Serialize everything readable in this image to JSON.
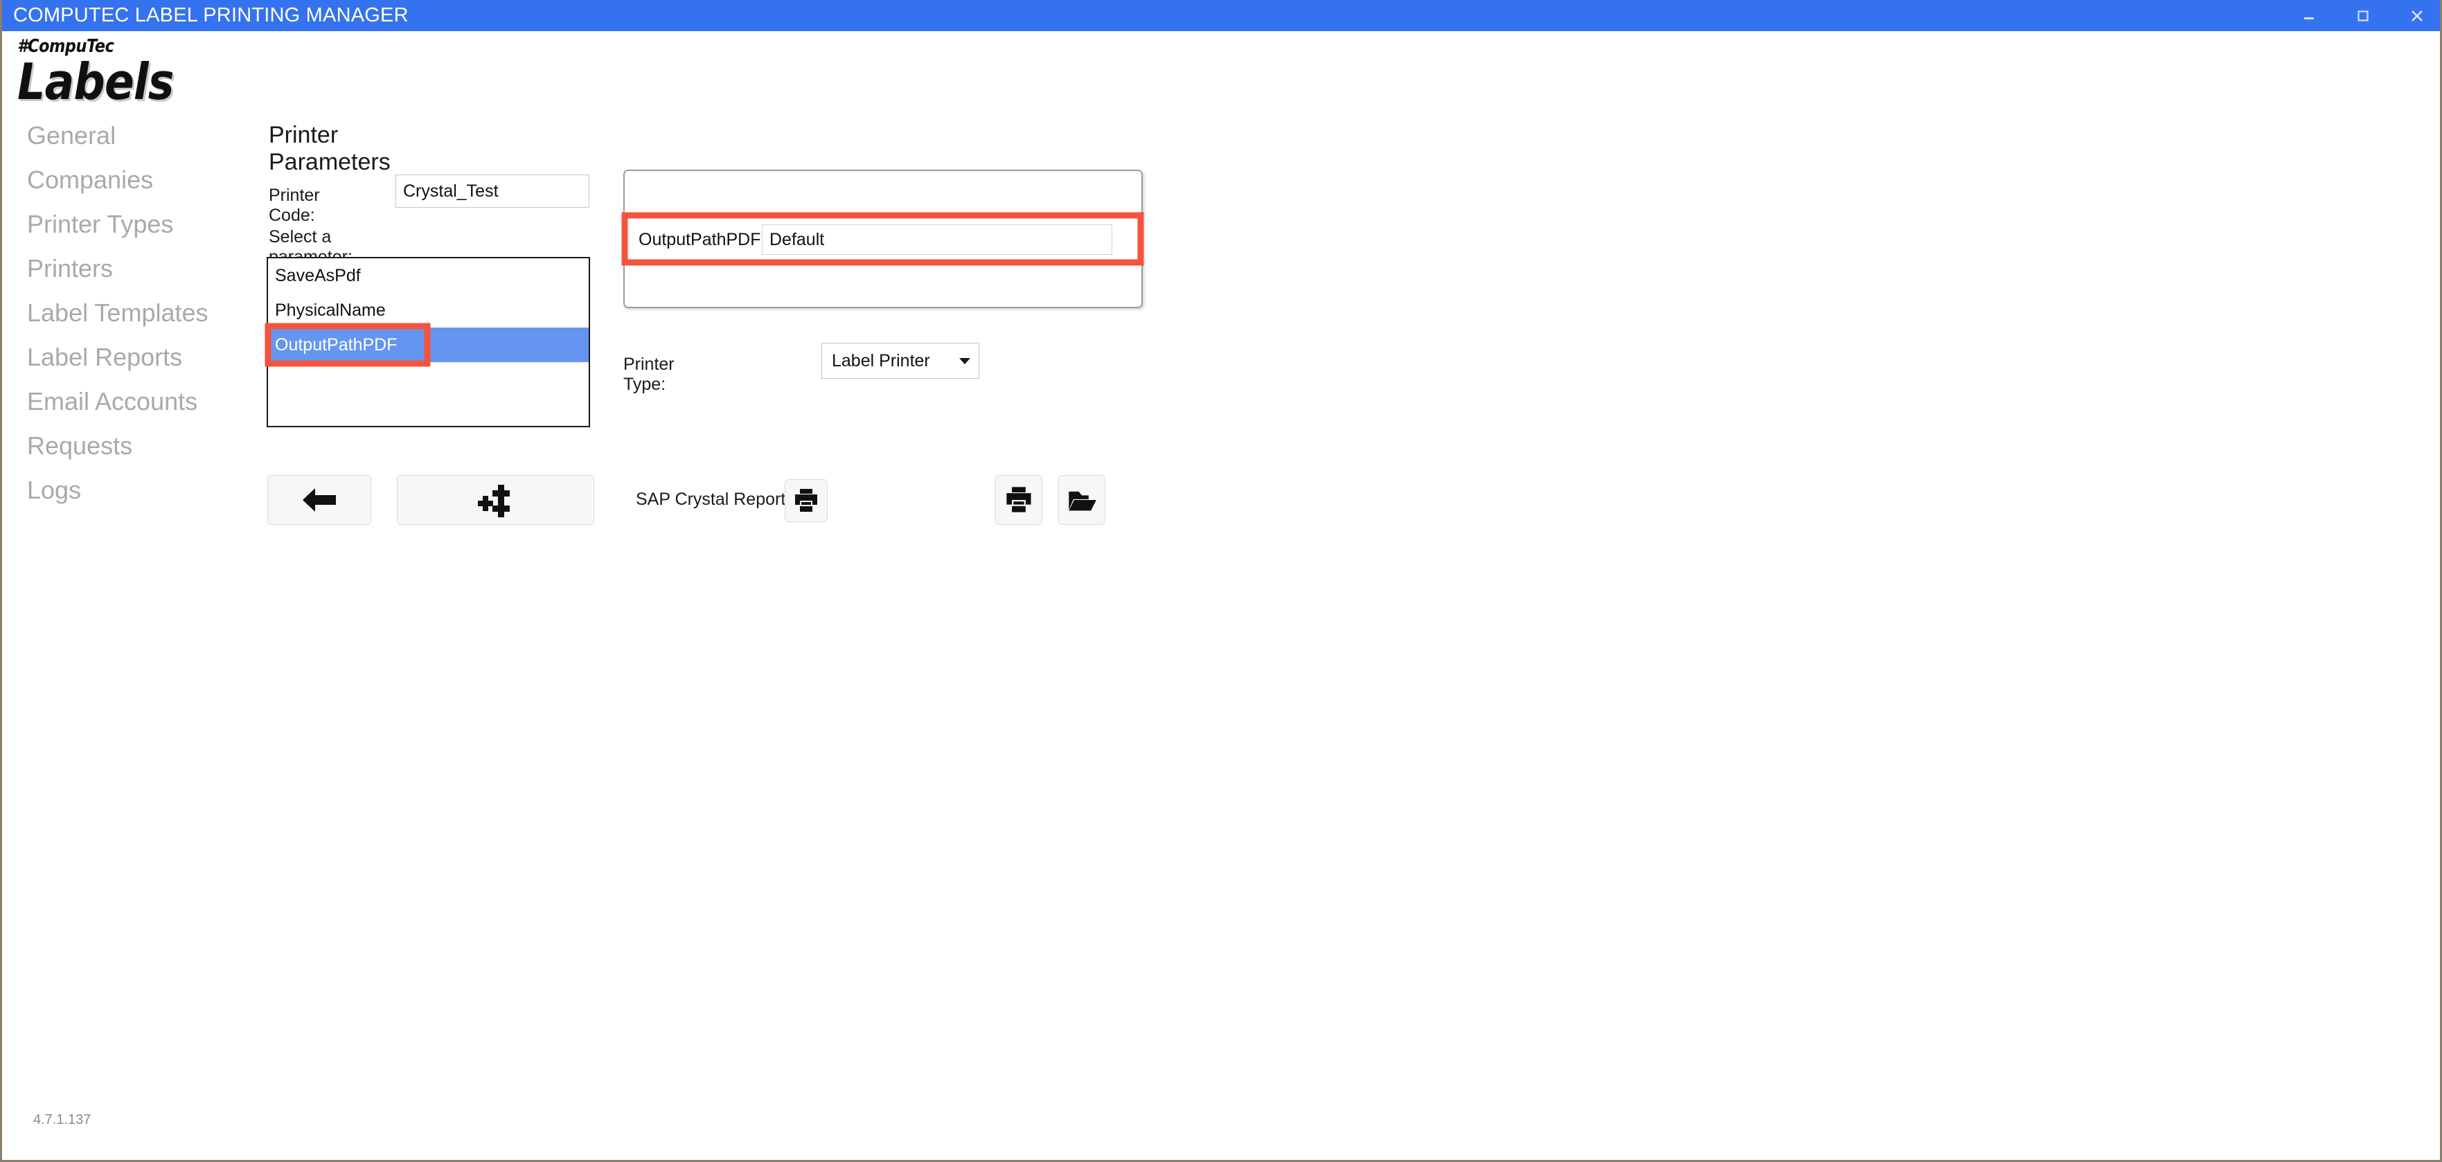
{
  "window": {
    "title": "COMPUTEC LABEL PRINTING MANAGER",
    "controls": {
      "minimize": "Minimize",
      "maximize": "Maximize",
      "close": "Close"
    },
    "title_bar_color": "#3572f0",
    "version": "4.7.1.137"
  },
  "logo": {
    "line1": "#CompuTec",
    "line2": "Labels"
  },
  "sidebar": {
    "items": [
      {
        "label": "General"
      },
      {
        "label": "Companies"
      },
      {
        "label": "Printer Types"
      },
      {
        "label": "Printers"
      },
      {
        "label": "Label Templates"
      },
      {
        "label": "Label Reports"
      },
      {
        "label": "Email Accounts"
      },
      {
        "label": "Requests"
      },
      {
        "label": "Logs"
      }
    ],
    "text_color": "#a9a9a9"
  },
  "main": {
    "page_title": "Printer Parameters",
    "printer_code": {
      "label": "Printer Code:",
      "value": "Crystal_Test"
    },
    "parameter_list": {
      "label": "Select a parameter:",
      "options": [
        {
          "label": "SaveAsPdf",
          "selected": false
        },
        {
          "label": "PhysicalName",
          "selected": false
        },
        {
          "label": "OutputPathPDF",
          "selected": true
        }
      ],
      "selected_value": "OutputPathPDF",
      "selection_color": "#6495f0"
    },
    "parameter_value_panel": {
      "rows": [
        {
          "name": "",
          "value": ""
        },
        {
          "name": "OutputPathPDF",
          "value": "Default"
        },
        {
          "name": "",
          "value": ""
        }
      ],
      "active_name": "OutputPathPDF",
      "active_value": "Default"
    },
    "printer_type": {
      "label": "Printer Type:",
      "selected": "Label Printer"
    },
    "sap_crystal_report": {
      "label": "SAP Crystal Report"
    },
    "buttons": {
      "back": "back-arrow",
      "add_parameters": "add-parameters",
      "crystal_print": "print",
      "print": "print",
      "open_folder": "open-folder"
    }
  },
  "annotations": {
    "highlight_color": "#f4543c",
    "boxes": [
      {
        "target": "list-option-outputpathpdf"
      },
      {
        "target": "parameter-value-row"
      }
    ]
  }
}
